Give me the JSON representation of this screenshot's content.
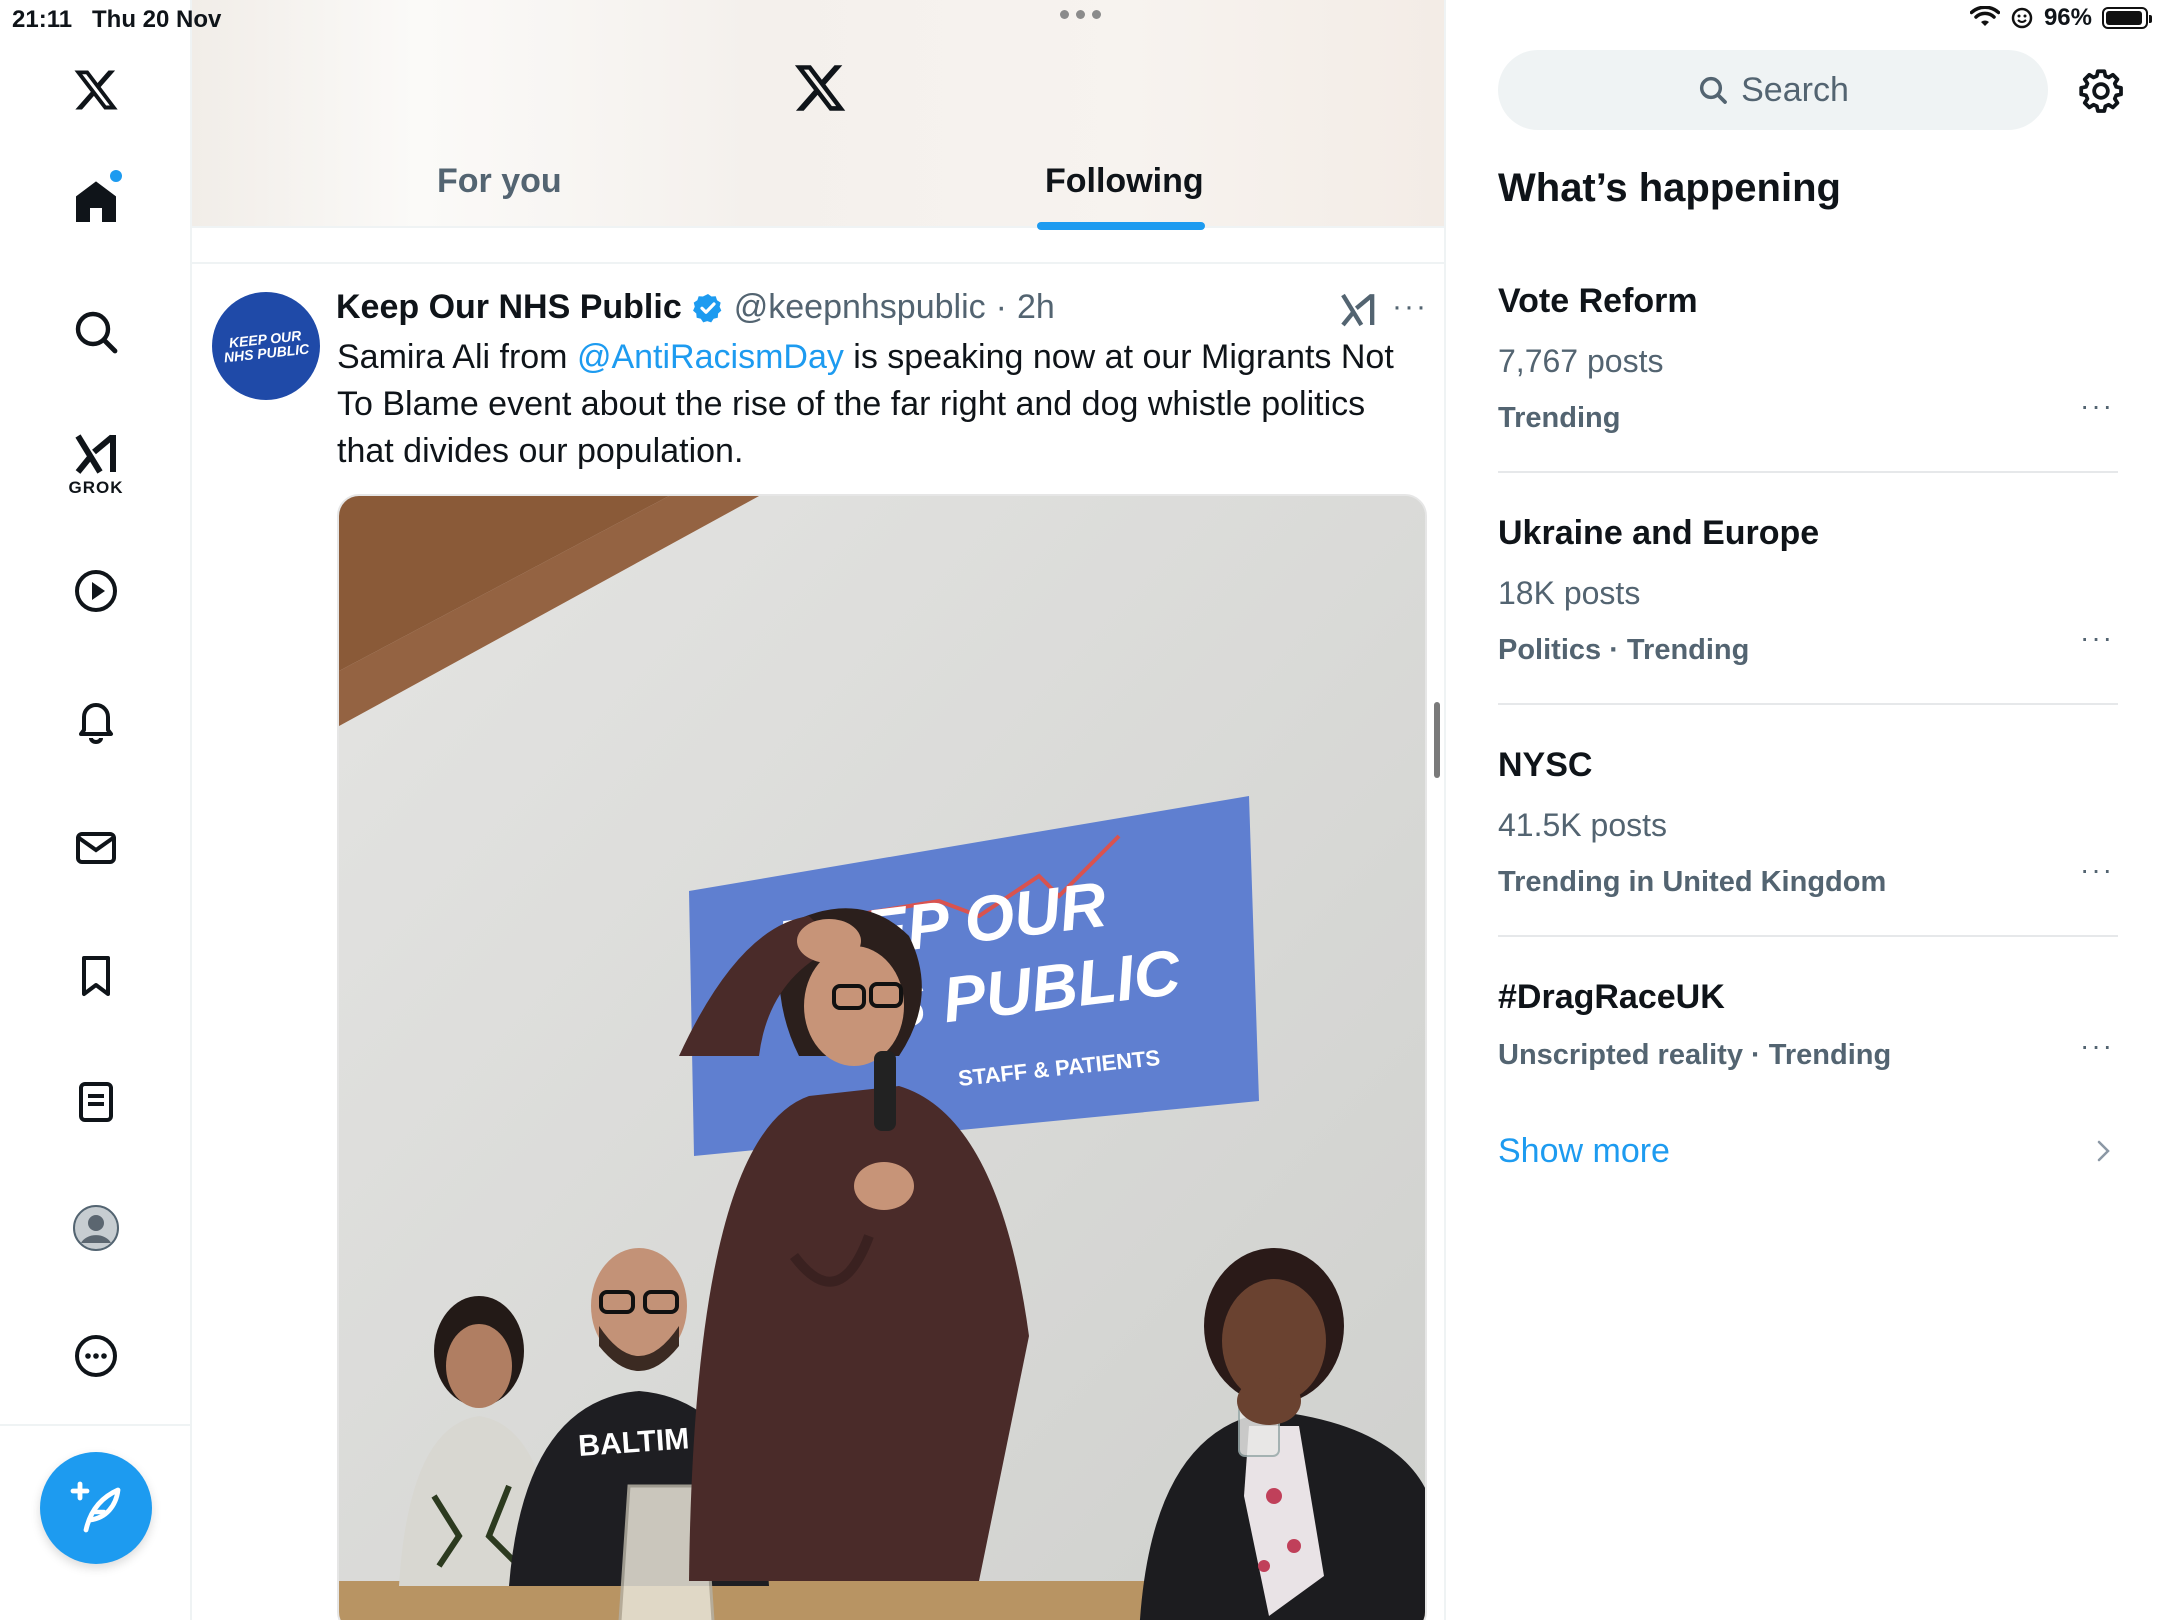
{
  "status_bar": {
    "time": "21:11",
    "date": "Thu 20 Nov",
    "battery": "96%",
    "battery_level": 0.96
  },
  "nav": {
    "items": [
      "Home",
      "Explore",
      "Grok",
      "Video",
      "Notifications",
      "Messages",
      "Bookmarks",
      "Lists",
      "Profile",
      "More"
    ],
    "grok_label": "GROK",
    "compose_icon": "compose-feather-plus-icon"
  },
  "feed": {
    "tabs": [
      {
        "label": "For you",
        "selected": false
      },
      {
        "label": "Following",
        "selected": true
      }
    ]
  },
  "tweet": {
    "avatar_text": "KEEP OUR\nNHS PUBLIC",
    "author_name": "Keep Our NHS Public",
    "handle": "@keepnhspublic",
    "separator": "·",
    "time": "2h",
    "more": "···",
    "text_before": "Samira Ali from ",
    "mention": "@AntiRacismDay",
    "text_after": " is speaking now at our Migrants Not To Blame event about the rise of the far right and dog whistle politics that divides our population.",
    "media": {
      "banner_line1": "KEEP OUR",
      "banner_line2": "NHS PUBLIC",
      "banner_sub": "STAFF & PATIENTS"
    }
  },
  "sidebar": {
    "search_placeholder": "Search",
    "section_title": "What’s happening",
    "trends": [
      {
        "title": "Vote Reform",
        "posts": "7,767 posts",
        "meta": "Trending"
      },
      {
        "title": "Ukraine and Europe",
        "posts": "18K posts",
        "meta": "Politics · Trending"
      },
      {
        "title": "NYSC",
        "posts": "41.5K posts",
        "meta": "Trending in United Kingdom"
      },
      {
        "title": "#DragRaceUK",
        "posts": "",
        "meta": "Unscripted reality · Trending"
      }
    ],
    "trend_more": "···",
    "show_more": "Show more"
  },
  "colors": {
    "accent": "#1d9bf0",
    "text_primary": "#0f1419",
    "text_secondary": "#536471"
  }
}
